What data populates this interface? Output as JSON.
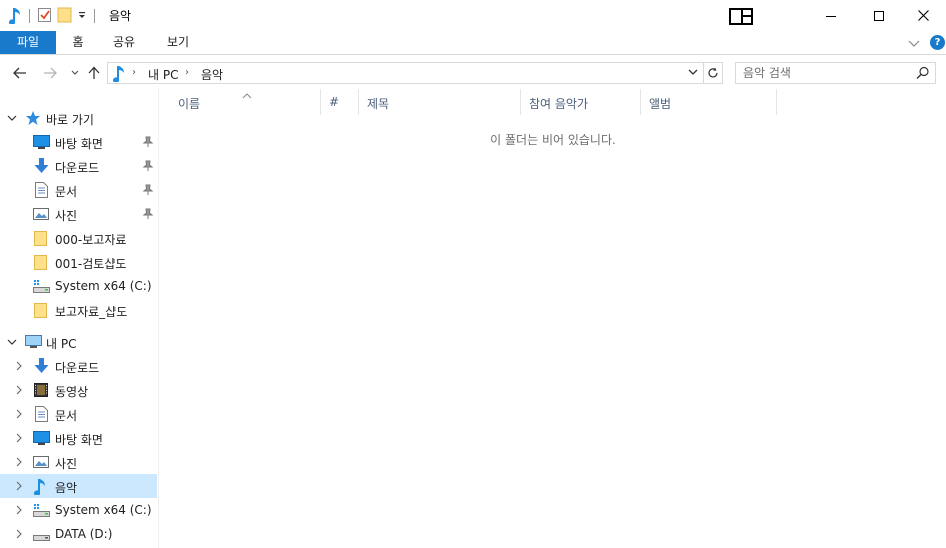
{
  "window": {
    "title": "음악",
    "accent": "#1979ca"
  },
  "ribbon": {
    "tabs": [
      "파일",
      "홈",
      "공유",
      "보기"
    ],
    "help": "?"
  },
  "address": {
    "crumbs": [
      "내 PC",
      "음악"
    ],
    "search_placeholder": "음악 검색"
  },
  "nav": {
    "quick_access": {
      "label": "바로 가기",
      "items": [
        {
          "label": "바탕 화면",
          "icon": "desktop-icon",
          "pinned": true
        },
        {
          "label": "다운로드",
          "icon": "download-icon",
          "pinned": true
        },
        {
          "label": "문서",
          "icon": "documents-icon",
          "pinned": true
        },
        {
          "label": "사진",
          "icon": "pictures-icon",
          "pinned": true
        },
        {
          "label": "000-보고자료",
          "icon": "folder-icon",
          "pinned": false
        },
        {
          "label": "001-검토샵도",
          "icon": "folder-icon",
          "pinned": false
        },
        {
          "label": "System x64 (C:)",
          "icon": "drive-icon",
          "pinned": false
        },
        {
          "label": "보고자료_샵도",
          "icon": "folder-icon",
          "pinned": false
        }
      ]
    },
    "this_pc": {
      "label": "내 PC",
      "items": [
        {
          "label": "다운로드",
          "icon": "download-icon"
        },
        {
          "label": "동영상",
          "icon": "videos-icon"
        },
        {
          "label": "문서",
          "icon": "documents-icon"
        },
        {
          "label": "바탕 화면",
          "icon": "desktop-icon"
        },
        {
          "label": "사진",
          "icon": "pictures-icon"
        },
        {
          "label": "음악",
          "icon": "music-icon",
          "selected": true
        },
        {
          "label": "System x64 (C:)",
          "icon": "drive-icon"
        },
        {
          "label": "DATA (D:)",
          "icon": "drive-icon"
        }
      ]
    }
  },
  "content": {
    "columns": [
      "이름",
      "#",
      "제목",
      "참여 음악가",
      "앨범"
    ],
    "empty_message": "이 폴더는 비어 있습니다."
  }
}
